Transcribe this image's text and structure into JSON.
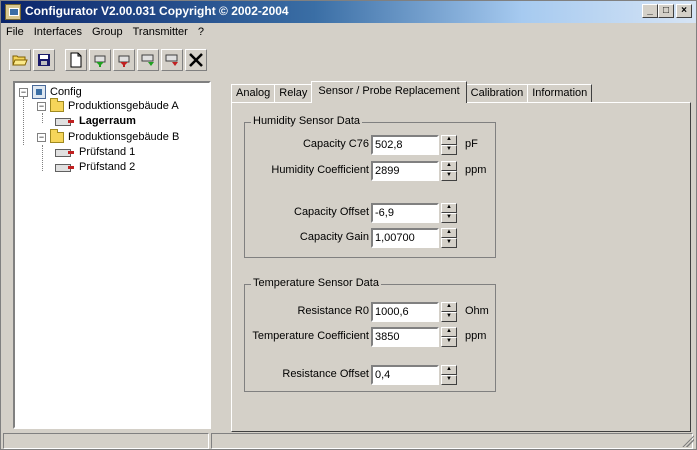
{
  "app": {
    "title": "Configurator  V2.00.031 Copyright © 2002-2004",
    "window_buttons": {
      "minimize": "_",
      "maximize": "□",
      "close": "×"
    }
  },
  "menu": [
    "File",
    "Interfaces",
    "Group",
    "Transmitter",
    "?"
  ],
  "toolbar": [
    {
      "name": "open-folder-icon"
    },
    {
      "name": "save-icon"
    },
    {
      "name": "new-document-icon"
    },
    {
      "name": "add-green-transmitter-icon"
    },
    {
      "name": "add-red-transmitter-icon"
    },
    {
      "name": "transmitter-green-icon"
    },
    {
      "name": "transmitter-red-icon"
    },
    {
      "name": "tools-icon"
    }
  ],
  "tree": {
    "root": "Config",
    "groups": [
      {
        "label": "Produktionsgebäude A",
        "children": [
          "Lagerraum"
        ]
      },
      {
        "label": "Produktionsgebäude B",
        "children": [
          "Prüfstand 1",
          "Prüfstand 2"
        ]
      }
    ],
    "selected": "Lagerraum"
  },
  "tabs": [
    "Analog",
    "Relay",
    "Sensor / Probe Replacement",
    "Calibration",
    "Information"
  ],
  "active_tab": "Sensor / Probe Replacement",
  "humidity": {
    "title": "Humidity Sensor Data",
    "capacity_c76": {
      "label": "Capacity C76",
      "value": "502,8",
      "unit": "pF"
    },
    "humidity_coefficient": {
      "label": "Humidity Coefficient",
      "value": "2899",
      "unit": "ppm"
    },
    "capacity_offset": {
      "label": "Capacity Offset",
      "value": "-6,9"
    },
    "capacity_gain": {
      "label": "Capacity Gain",
      "value": "1,00700"
    }
  },
  "temperature": {
    "title": "Temperature Sensor Data",
    "resistance_r0": {
      "label": "Resistance R0",
      "value": "1000,6",
      "unit": "Ohm"
    },
    "temperature_coefficient": {
      "label": "Temperature Coefficient",
      "value": "3850",
      "unit": "ppm"
    },
    "resistance_offset": {
      "label": "Resistance Offset",
      "value": "0,4"
    }
  }
}
